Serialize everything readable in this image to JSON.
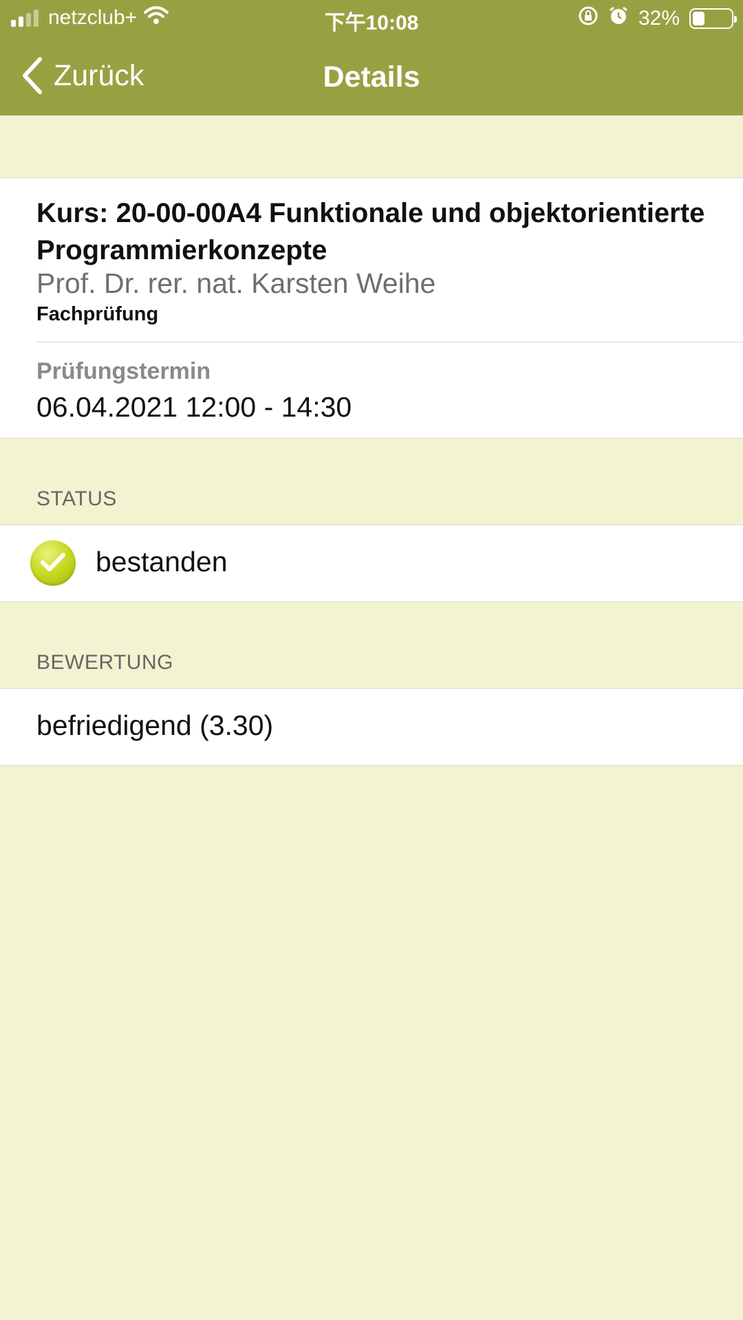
{
  "status_bar": {
    "carrier": "netzclub+",
    "time": "下午10:08",
    "battery_percent": "32%",
    "battery_level": 0.32
  },
  "nav": {
    "back_label": "Zurück",
    "title": "Details"
  },
  "course": {
    "title": "Kurs: 20-00-00A4 Funktionale und objektorientierte Programmierkonzepte",
    "professor": "Prof. Dr. rer. nat. Karsten Weihe",
    "exam_type": "Fachprüfung",
    "date_label": "Prüfungstermin",
    "date_value": "06.04.2021 12:00 - 14:30"
  },
  "status_section": {
    "header": "STATUS",
    "value": "bestanden",
    "icon": "check-circle-icon"
  },
  "grade_section": {
    "header": "BEWERTUNG",
    "value": "befriedigend (3.30)"
  },
  "colors": {
    "accent": "#98a142",
    "background": "#f3f3d1",
    "passed": "#c6d81f"
  }
}
